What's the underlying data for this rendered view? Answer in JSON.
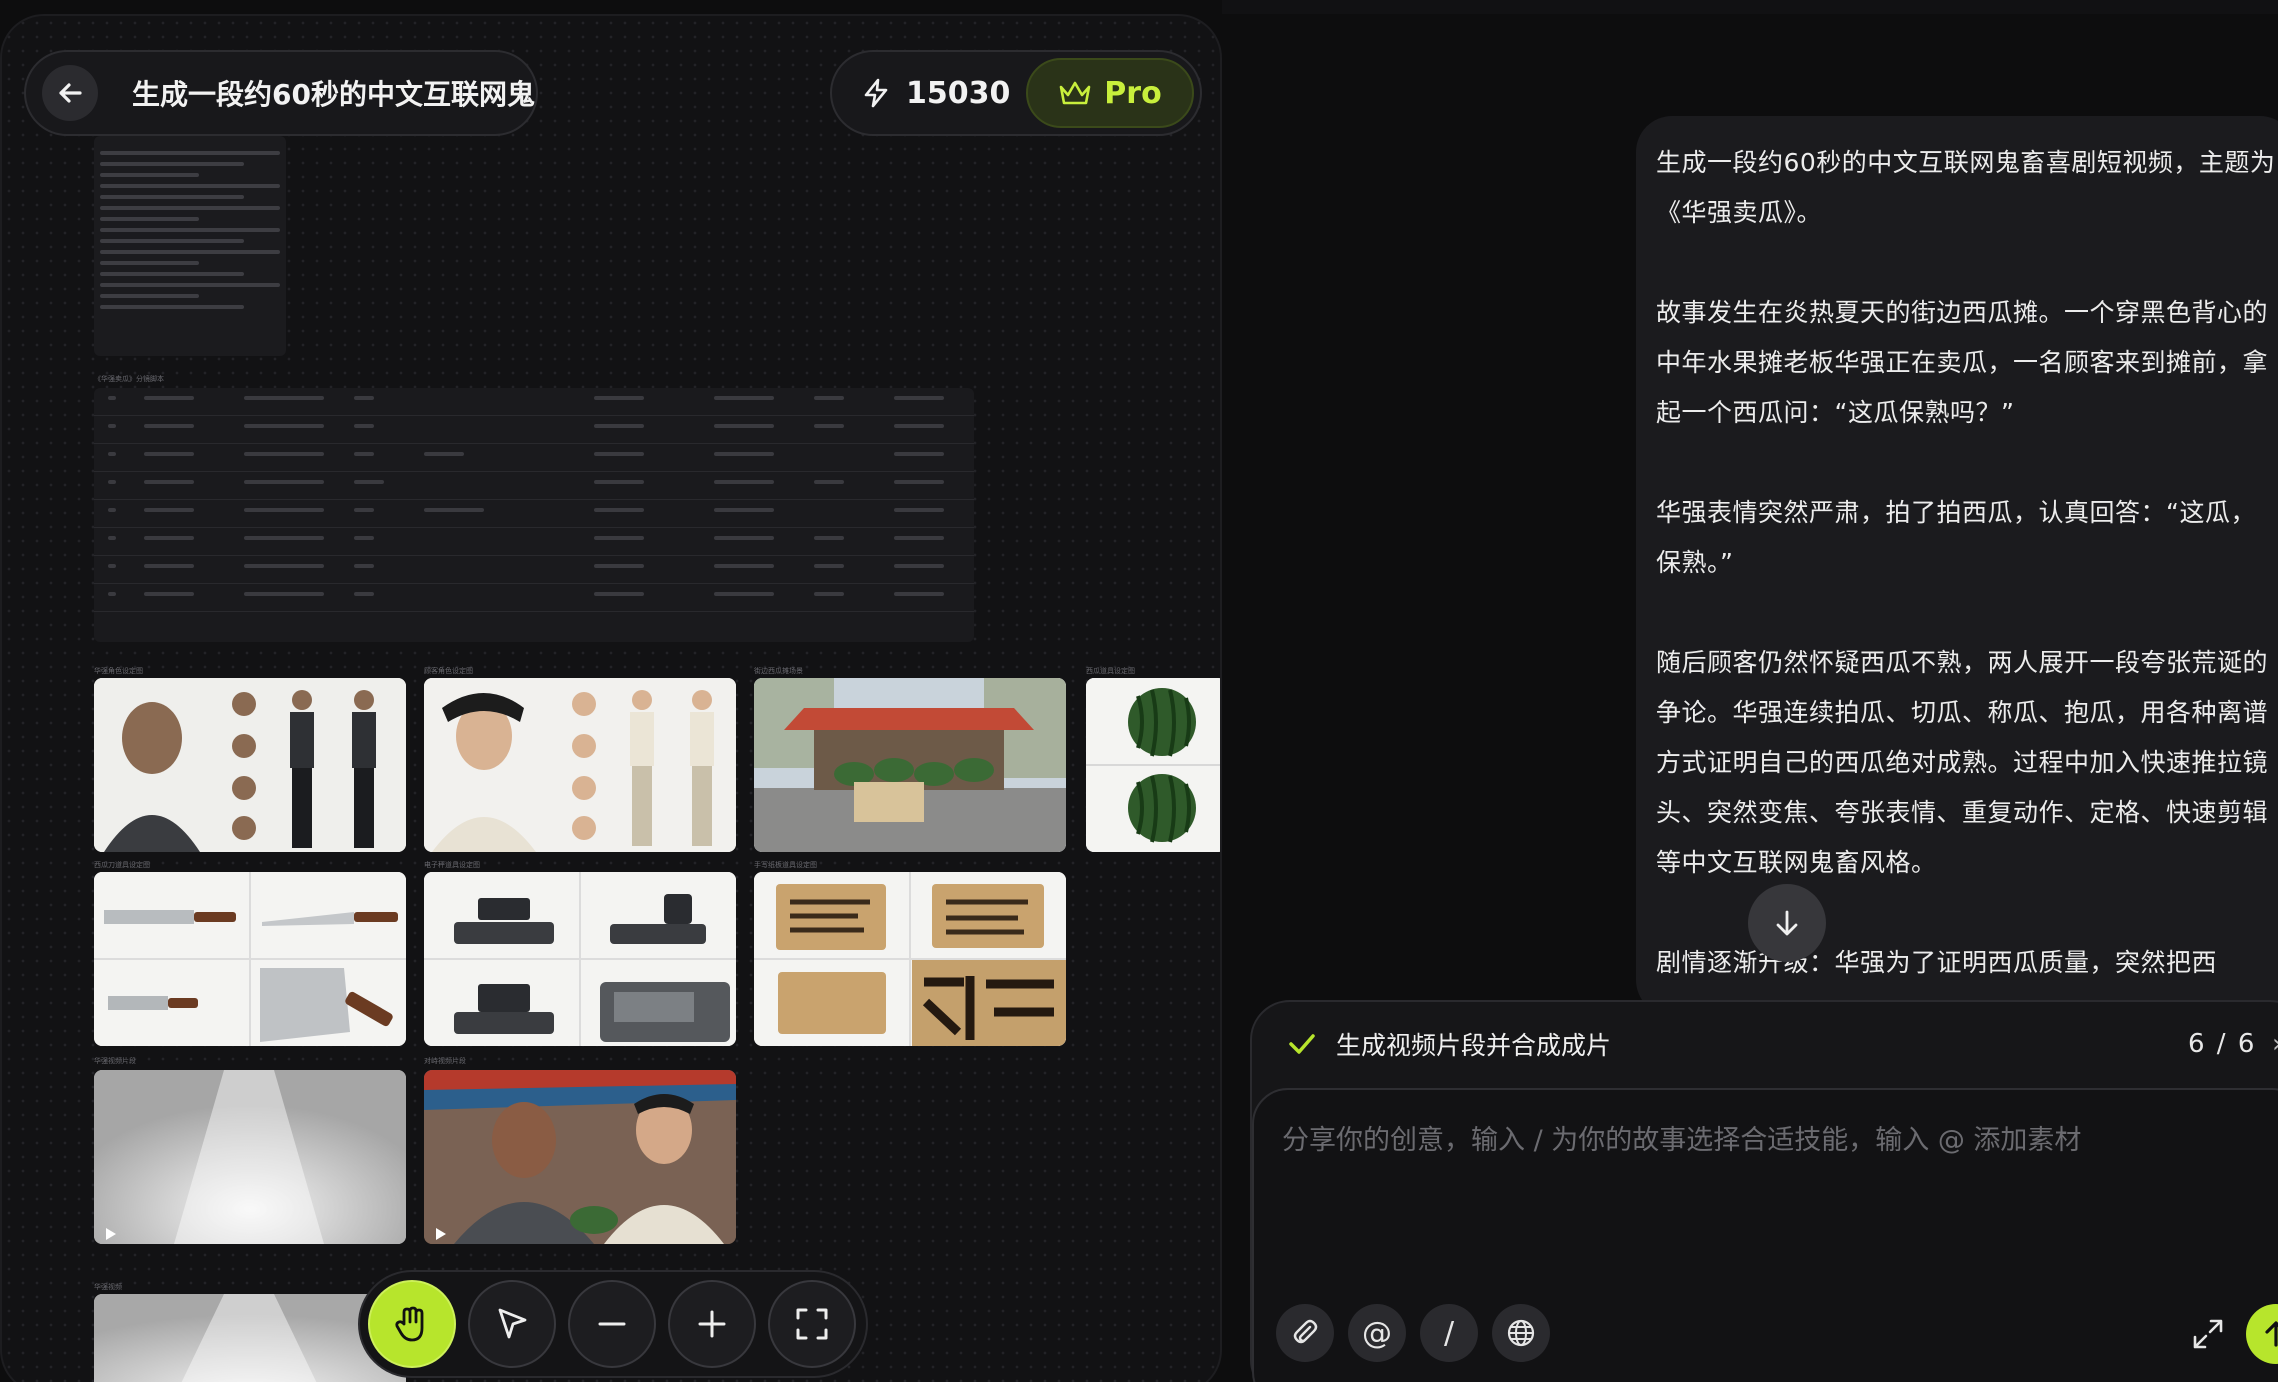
{
  "header": {
    "project_title": "生成一段约60秒的中文互联网鬼",
    "credits": "15030",
    "pro_label": "Pro"
  },
  "canvas": {
    "table_label": "《华强卖瓜》分镜脚本",
    "assets": [
      {
        "label": "华强角色设定图"
      },
      {
        "label": "顾客角色设定图"
      },
      {
        "label": "街边西瓜摊场景"
      },
      {
        "label": "西瓜道具设定图"
      },
      {
        "label": "西瓜刀道具设定图"
      },
      {
        "label": "电子秤道具设定图"
      },
      {
        "label": "手写纸板道具设定图"
      },
      {
        "label": "华强视频片段"
      },
      {
        "label": "对峙视频片段"
      },
      {
        "label": "华强视频"
      }
    ]
  },
  "toolbar": {
    "tools": [
      "hand-icon",
      "select-arrow-icon",
      "zoom-out-icon",
      "zoom-in-icon",
      "fit-screen-icon"
    ]
  },
  "chat": {
    "message_paragraphs": [
      "生成一段约60秒的中文互联网鬼畜喜剧短视频，主题为《华强卖瓜》。",
      "故事发生在炎热夏天的街边西瓜摊。一个穿黑色背心的中年水果摊老板华强正在卖瓜，一名顾客来到摊前，拿起一个西瓜问：“这瓜保熟吗？”",
      "华强表情突然严肃，拍了拍西瓜，认真回答：“这瓜，保熟。”",
      "随后顾客仍然怀疑西瓜不熟，两人展开一段夸张荒诞的争论。华强连续拍瓜、切瓜、称瓜、抱瓜，用各种离谱方式证明自己的西瓜绝对成熟。过程中加入快速推拉镜头、突然变焦、夸张表情、重复动作、定格、快速剪辑等中文互联网鬼畜风格。",
      "剧情逐渐升级：华强为了证明西瓜质量，突然把西"
    ]
  },
  "composer": {
    "task_label": "生成视频片段并合成成片",
    "task_progress": "6 / 6",
    "placeholder": "分享你的创意，输入 / 为你的故事选择合适技能，输入 @ 添加素材",
    "at_label": "@",
    "slash_label": "/"
  },
  "colors": {
    "accent": "#b7e52c",
    "background": "#0d0d0e",
    "panel": "#1b1b1e"
  }
}
